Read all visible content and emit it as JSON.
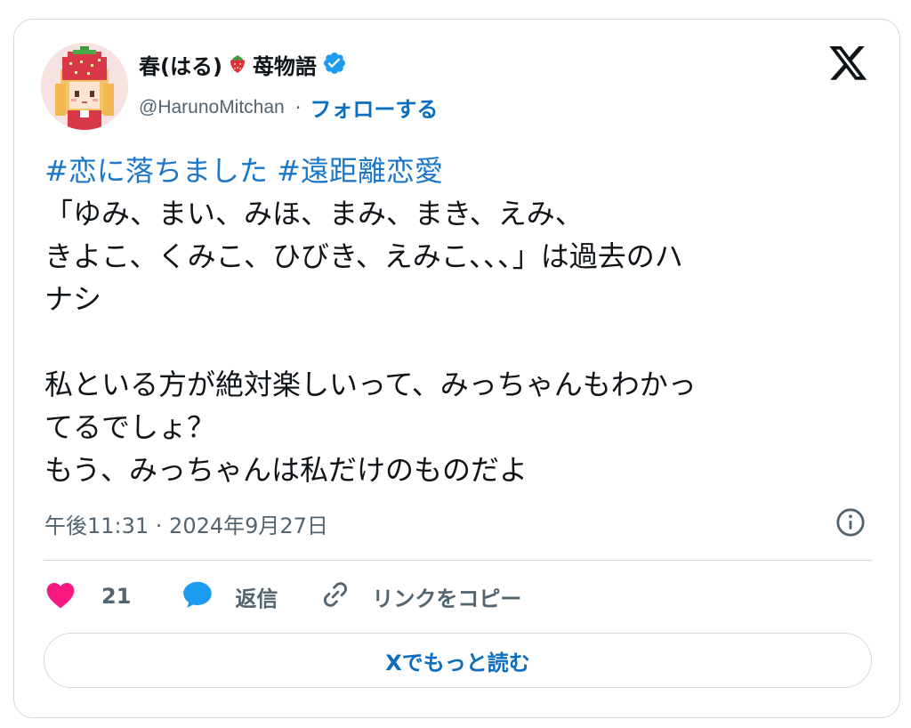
{
  "author": {
    "display_name": "春(はる)",
    "name_suffix": "苺物語",
    "handle": "@HarunoMitchan",
    "separator": "·",
    "follow_label": "フォローする",
    "verified": true
  },
  "tweet": {
    "hashtags": [
      "#恋に落ちました",
      "#遠距離恋愛"
    ],
    "lines": [
      "「ゆみ、まい、みほ、まみ、まき、えみ、",
      "きよこ、くみこ、ひびき、えみこ､､､」は過去のハ",
      "ナシ",
      "",
      "私といる方が絶対楽しいって、みっちゃんもわかっ",
      "てるでしょ？",
      "もう、みっちゃんは私だけのものだよ"
    ],
    "timestamp": "午後11:31 · 2024年9月27日"
  },
  "actions": {
    "like_count": "21",
    "reply_label": "返信",
    "copy_link_label": "リンクをコピー"
  },
  "read_more_label": "Xでもっと読む",
  "icons": {
    "brand": "x-logo-icon",
    "verified": "verified-badge-icon",
    "emoji": "strawberry-icon",
    "info": "info-icon",
    "like": "heart-icon",
    "reply": "speech-bubble-icon",
    "copy": "link-icon"
  },
  "colors": {
    "link_blue": "#0a6dbf",
    "hashtag_blue": "#1d77c9",
    "verified_blue": "#1d9bf0",
    "heart_pink": "#f91880",
    "secondary_text": "#536471",
    "border": "#cfd9de"
  }
}
